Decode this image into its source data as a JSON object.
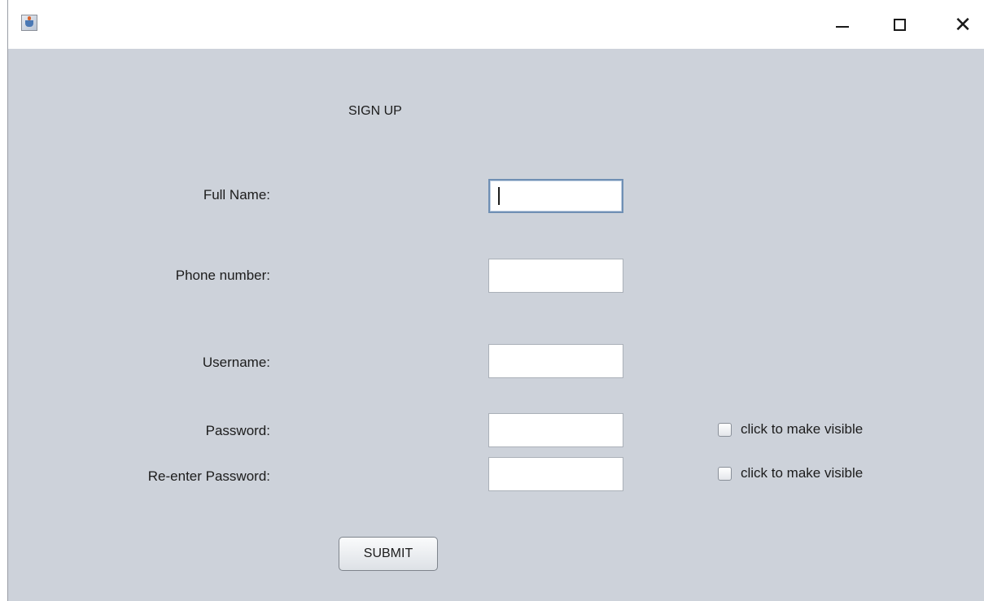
{
  "window": {
    "app_icon": "java-cup-icon",
    "controls": {
      "minimize": "minimize-icon",
      "maximize": "maximize-icon",
      "close_glyph": "✕"
    }
  },
  "form": {
    "heading": "SIGN UP",
    "fields": {
      "full_name": {
        "label": "Full Name:",
        "value": ""
      },
      "phone": {
        "label": "Phone number:",
        "value": ""
      },
      "username": {
        "label": "Username:",
        "value": ""
      },
      "password": {
        "label": "Password:",
        "value": ""
      },
      "reenter_password": {
        "label": "Re-enter Password:",
        "value": ""
      }
    },
    "visibility_checkboxes": {
      "password": {
        "label": "click to make visible",
        "checked": false
      },
      "reenter_password": {
        "label": "click to make visible",
        "checked": false
      }
    },
    "submit_label": "SUBMIT"
  },
  "colors": {
    "background": "#cdd2da",
    "focus_border": "#6f8fb4"
  }
}
